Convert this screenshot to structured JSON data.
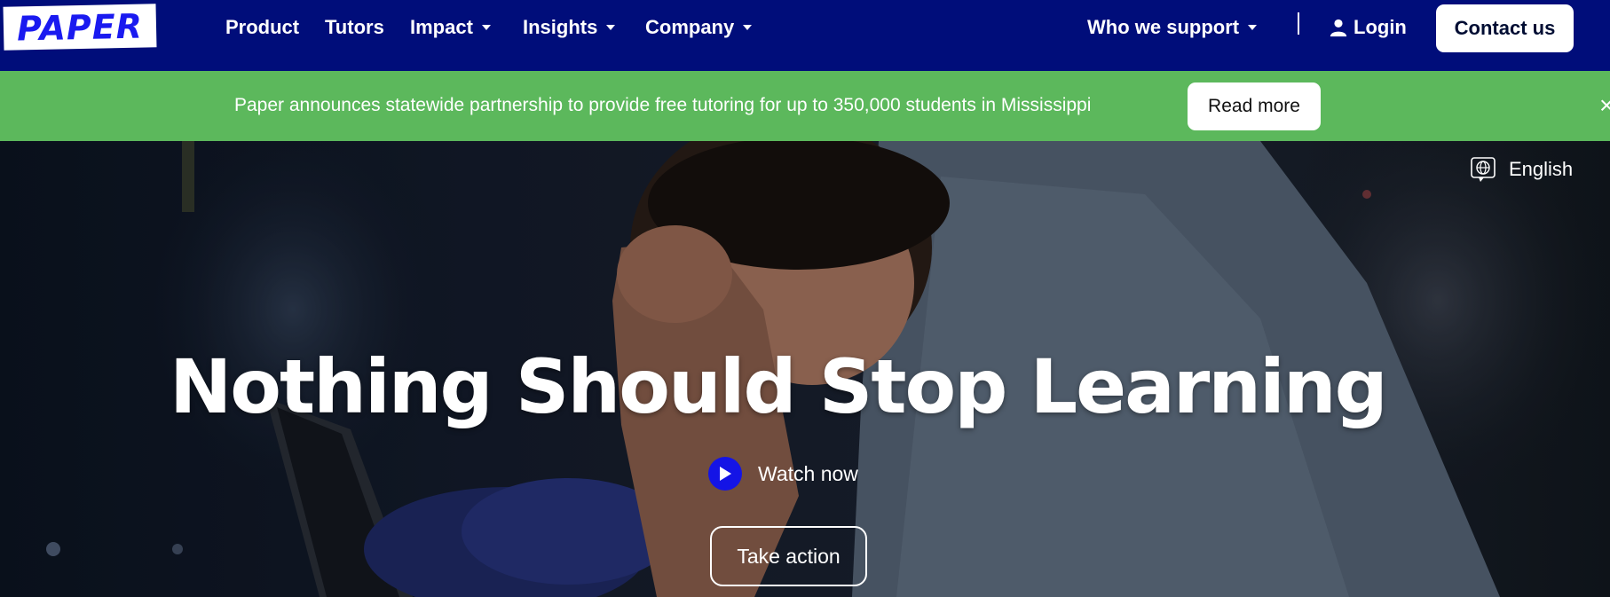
{
  "nav": {
    "logo": "PAPER",
    "links": [
      {
        "label": "Product"
      },
      {
        "label": "Tutors"
      },
      {
        "label": "Impact"
      },
      {
        "label": "Insights"
      },
      {
        "label": "Company"
      }
    ],
    "who_we_support": "Who we support",
    "login": "Login",
    "contact": "Contact us",
    "colors": {
      "background": "#000d7a",
      "logo": "#1a1af0"
    }
  },
  "banner": {
    "text": "Paper announces statewide partnership to provide free tutoring for up to 350,000 students in Mississippi",
    "button": "Read more",
    "close": "×",
    "color": "#5cb85c"
  },
  "hero": {
    "language": "English",
    "language_icon": "globe-icon",
    "headline": "Nothing Should Stop Learning",
    "watch": "Watch now",
    "play_icon": "play-icon",
    "cta": "Take action",
    "accent": "#1414e6"
  }
}
